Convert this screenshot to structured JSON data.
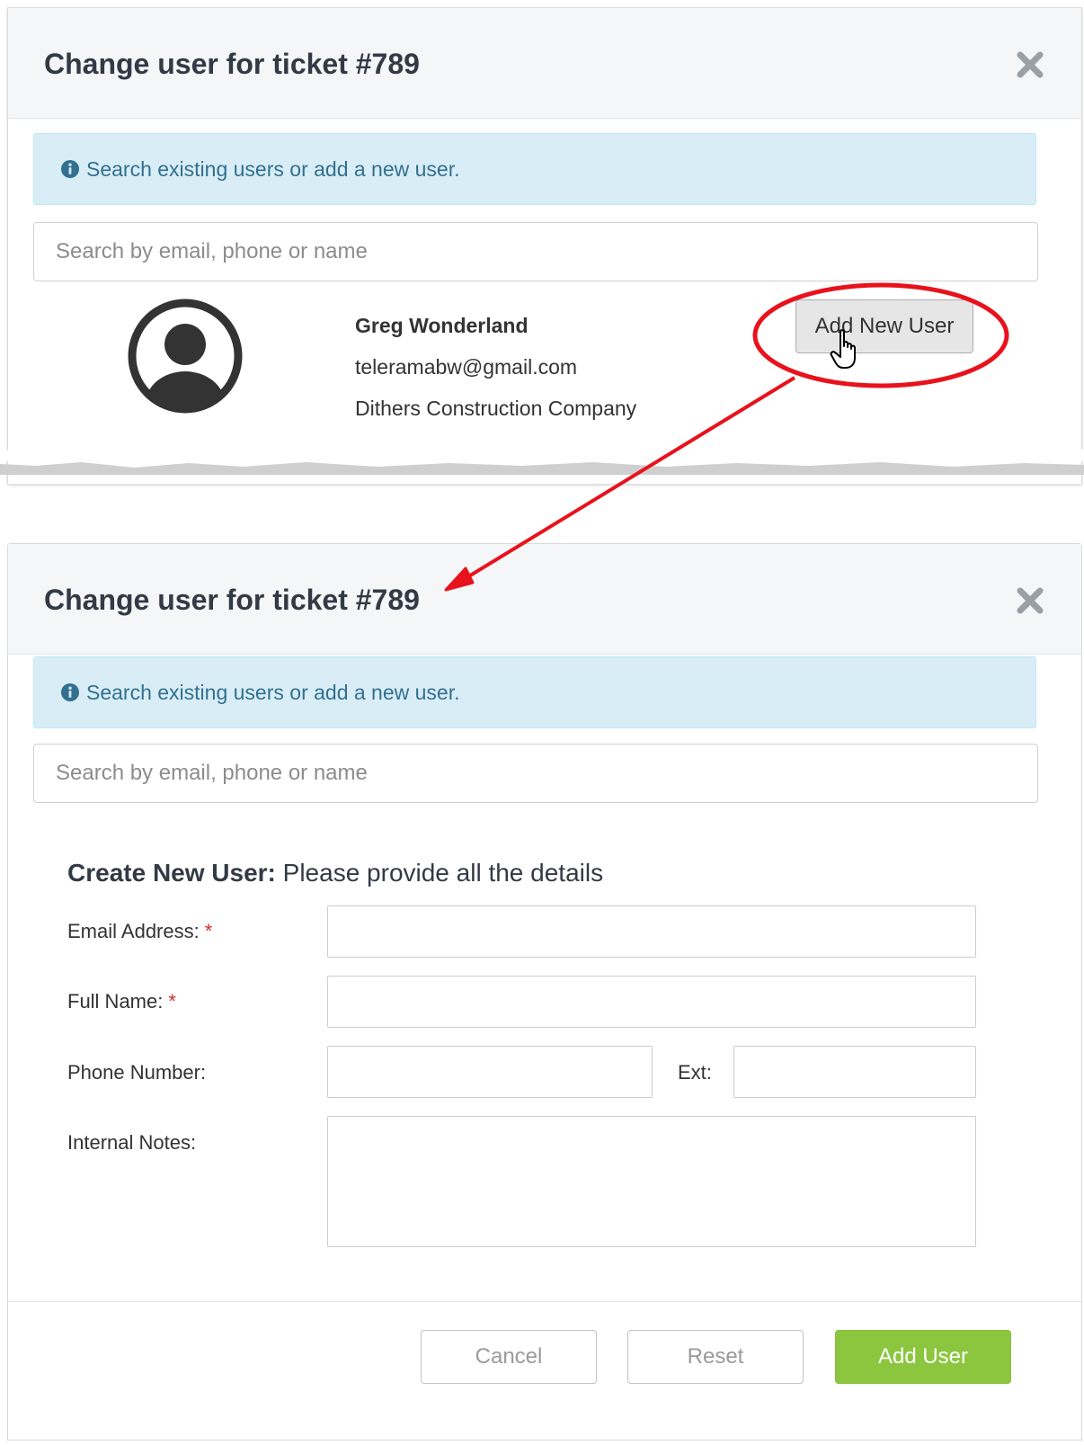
{
  "modal": {
    "title": "Change user for ticket #789",
    "close_icon": "close-icon",
    "info_icon": "info-circle-icon",
    "info_text": "Search existing users or add a new user.",
    "search_placeholder": "Search by email, phone or name"
  },
  "search_result": {
    "name": "Greg Wonderland",
    "email": "teleramabw@gmail.com",
    "company": "Dithers Construction Company",
    "avatar_icon": "user-avatar-icon",
    "add_new_user_label": "Add New User"
  },
  "create_form": {
    "heading_bold": "Create New User:",
    "heading_rest": " Please provide all the details",
    "email_label": "Email Address:",
    "full_name_label": "Full Name:",
    "required_marker": "*",
    "phone_label": "Phone Number:",
    "ext_label": "Ext:",
    "notes_label": "Internal Notes:",
    "email_value": "",
    "full_name_value": "",
    "phone_value": "",
    "ext_value": "",
    "notes_value": ""
  },
  "footer": {
    "cancel_label": "Cancel",
    "reset_label": "Reset",
    "add_user_label": "Add User"
  },
  "colors": {
    "annotation": "#e8121c",
    "add_user_button": "#8cc63f",
    "info_background": "#d9edf7",
    "info_text": "#31708f"
  }
}
